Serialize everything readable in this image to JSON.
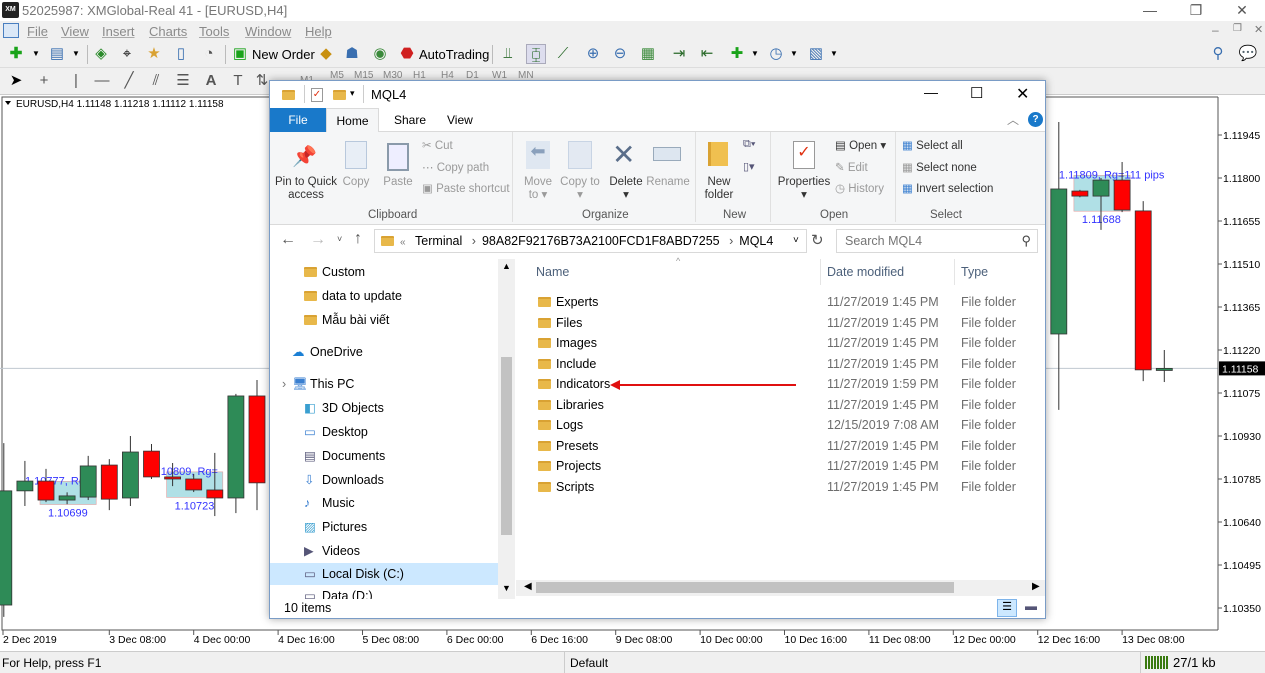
{
  "app": {
    "title": "52025987: XMGlobal-Real 41 - [EURUSD,H4]",
    "logo": "XM",
    "menu": [
      "File",
      "View",
      "Insert",
      "Charts",
      "Tools",
      "Window",
      "Help"
    ],
    "toolbar": {
      "new_order": "New Order",
      "autotrading": "AutoTrading"
    },
    "timeframes": [
      "M1",
      "M5",
      "M15",
      "M30",
      "H1",
      "H4",
      "D1",
      "W1",
      "MN"
    ],
    "status": {
      "help": "For Help, press F1",
      "profile": "Default",
      "traffic": "27/1 kb"
    }
  },
  "chart_data": {
    "type": "candlestick",
    "symbol_info": "EURUSD,H4  1.11148 1.11218 1.11112 1.11158",
    "current_price": "1.11158",
    "y_ticks": [
      "1.11945",
      "1.11800",
      "1.11655",
      "1.11510",
      "1.11365",
      "1.11220",
      "1.11075",
      "1.10930",
      "1.10785",
      "1.10640",
      "1.10495",
      "1.10350"
    ],
    "ylim": [
      1.103,
      1.1215
    ],
    "x_ticks": [
      {
        "t": "2019-12-02T00:00",
        "label": "2 Dec 2019"
      },
      {
        "t": "2019-12-03T08:00",
        "label": "3 Dec 08:00"
      },
      {
        "t": "2019-12-04T00:00",
        "label": "4 Dec 00:00"
      },
      {
        "t": "2019-12-04T16:00",
        "label": "4 Dec 16:00"
      },
      {
        "t": "2019-12-05T08:00",
        "label": "5 Dec 08:00"
      },
      {
        "t": "2019-12-06T00:00",
        "label": "6 Dec 00:00"
      },
      {
        "t": "2019-12-06T16:00",
        "label": "6 Dec 16:00"
      },
      {
        "t": "2019-12-09T08:00",
        "label": "9 Dec 08:00"
      },
      {
        "t": "2019-12-10T00:00",
        "label": "10 Dec 00:00"
      },
      {
        "t": "2019-12-10T16:00",
        "label": "10 Dec 16:00"
      },
      {
        "t": "2019-12-11T08:00",
        "label": "11 Dec 08:00"
      },
      {
        "t": "2019-12-12T00:00",
        "label": "12 Dec 00:00"
      },
      {
        "t": "2019-12-12T16:00",
        "label": "12 Dec 16:00"
      },
      {
        "t": "2019-12-13T08:00",
        "label": "13 Dec 08:00"
      }
    ],
    "candles": [
      {
        "t": "2019-12-02T12:00",
        "o": 1.1036,
        "h": 1.10906,
        "l": 1.1032,
        "c": 1.10745
      },
      {
        "t": "2019-12-02T16:00",
        "o": 1.10745,
        "h": 1.10846,
        "l": 1.10694,
        "c": 1.10778
      },
      {
        "t": "2019-12-02T20:00",
        "o": 1.10778,
        "h": 1.10819,
        "l": 1.10707,
        "c": 1.10714
      },
      {
        "t": "2019-12-03T00:00",
        "o": 1.10714,
        "h": 1.1074,
        "l": 1.107,
        "c": 1.10728
      },
      {
        "t": "2019-12-03T04:00",
        "o": 1.10724,
        "h": 1.10863,
        "l": 1.10714,
        "c": 1.10829
      },
      {
        "t": "2019-12-03T08:00",
        "o": 1.10832,
        "h": 1.10852,
        "l": 1.1068,
        "c": 1.10717
      },
      {
        "t": "2019-12-03T12:00",
        "o": 1.10721,
        "h": 1.1093,
        "l": 1.10694,
        "c": 1.10876
      },
      {
        "t": "2019-12-03T16:00",
        "o": 1.10879,
        "h": 1.10903,
        "l": 1.10785,
        "c": 1.10792
      },
      {
        "t": "2019-12-03T20:00",
        "o": 1.10792,
        "h": 1.10839,
        "l": 1.10761,
        "c": 1.10785
      },
      {
        "t": "2019-12-04T00:00",
        "o": 1.10785,
        "h": 1.10802,
        "l": 1.10741,
        "c": 1.10748
      },
      {
        "t": "2019-12-04T04:00",
        "o": 1.10748,
        "h": 1.10873,
        "l": 1.1066,
        "c": 1.10721
      },
      {
        "t": "2019-12-04T08:00",
        "o": 1.10721,
        "h": 1.11072,
        "l": 1.1067,
        "c": 1.11065
      },
      {
        "t": "2019-12-04T12:00",
        "o": 1.11065,
        "h": 1.11119,
        "l": 1.1068,
        "c": 1.10772
      },
      {
        "t": "2019-12-12T20:00",
        "o": 1.11274,
        "h": 1.11989,
        "l": 1.11018,
        "c": 1.11763
      },
      {
        "t": "2019-12-13T00:00",
        "o": 1.11756,
        "h": 1.1176,
        "l": 1.11735,
        "c": 1.11739
      },
      {
        "t": "2019-12-13T04:00",
        "o": 1.11739,
        "h": 1.118,
        "l": 1.11625,
        "c": 1.11793
      },
      {
        "t": "2019-12-13T08:00",
        "o": 1.11793,
        "h": 1.11854,
        "l": 1.11685,
        "c": 1.11692
      },
      {
        "t": "2019-12-13T12:00",
        "o": 1.11689,
        "h": 1.11722,
        "l": 1.11115,
        "c": 1.11153
      },
      {
        "t": "2019-12-13T16:00",
        "o": 1.11151,
        "h": 1.1122,
        "l": 1.11112,
        "c": 1.11158
      }
    ],
    "ranges": [
      {
        "t1": "2019-12-02T20:00",
        "t2": "2019-12-03T04:00",
        "hi": 1.10777,
        "lo": 1.10699,
        "top_label": "1.10777, Rg=",
        "bottom_label": "1.10699"
      },
      {
        "t1": "2019-12-03T20:00",
        "t2": "2019-12-04T04:00",
        "hi": 1.10809,
        "lo": 1.10723,
        "top_label": "1.10809, Rg=",
        "bottom_label": "1.10723"
      },
      {
        "t1": "2019-12-13T00:00",
        "t2": "2019-12-13T08:00",
        "hi": 1.11809,
        "lo": 1.11688,
        "top_label": "1.11809, Rg=111 pips",
        "bottom_label": "1.11688"
      }
    ],
    "colors": {
      "bull": "#2e8b57",
      "bear": "#ff0000",
      "range_fill": "#b0e0e6",
      "label": "#3333ff"
    }
  },
  "explorer": {
    "title": "MQL4",
    "tabs": [
      "File",
      "Home",
      "Share",
      "View"
    ],
    "active_tab": "Home",
    "ribbon": {
      "pin": "Pin to Quick access",
      "copy": "Copy",
      "paste": "Paste",
      "cut": "Cut",
      "copy_path": "Copy path",
      "paste_shortcut": "Paste shortcut",
      "clipboard": "Clipboard",
      "move_to": "Move to",
      "copy_to": "Copy to",
      "delete": "Delete",
      "rename": "Rename",
      "organize": "Organize",
      "new_folder": "New folder",
      "new": "New",
      "properties": "Properties",
      "open": "Open",
      "edit": "Edit",
      "history": "History",
      "open_grp": "Open",
      "select_all": "Select all",
      "select_none": "Select none",
      "invert": "Invert selection",
      "select": "Select"
    },
    "address": [
      "Terminal",
      "98A82F92176B73A2100FCD1F8ABD7255",
      "MQL4"
    ],
    "search_placeholder": "Search MQL4",
    "nav": [
      {
        "label": "Custom",
        "icon": "folder"
      },
      {
        "label": "data to update",
        "icon": "folder"
      },
      {
        "label": "Mẫu bài viết",
        "icon": "folder"
      },
      {
        "label": "OneDrive",
        "icon": "cloud"
      },
      {
        "label": "This PC",
        "icon": "computer"
      },
      {
        "label": "3D Objects",
        "icon": "3d"
      },
      {
        "label": "Desktop",
        "icon": "desktop"
      },
      {
        "label": "Documents",
        "icon": "documents"
      },
      {
        "label": "Downloads",
        "icon": "download"
      },
      {
        "label": "Music",
        "icon": "music"
      },
      {
        "label": "Pictures",
        "icon": "pictures"
      },
      {
        "label": "Videos",
        "icon": "videos"
      },
      {
        "label": "Local Disk (C:)",
        "icon": "drive",
        "selected": true
      },
      {
        "label": "Data (D:)",
        "icon": "drive"
      }
    ],
    "columns": [
      "Name",
      "Date modified",
      "Type"
    ],
    "files": [
      {
        "name": "Experts",
        "date": "11/27/2019 1:45 PM",
        "type": "File folder"
      },
      {
        "name": "Files",
        "date": "11/27/2019 1:45 PM",
        "type": "File folder"
      },
      {
        "name": "Images",
        "date": "11/27/2019 1:45 PM",
        "type": "File folder"
      },
      {
        "name": "Include",
        "date": "11/27/2019 1:45 PM",
        "type": "File folder"
      },
      {
        "name": "Indicators",
        "date": "11/27/2019 1:59 PM",
        "type": "File folder"
      },
      {
        "name": "Libraries",
        "date": "11/27/2019 1:45 PM",
        "type": "File folder"
      },
      {
        "name": "Logs",
        "date": "12/15/2019 7:08 AM",
        "type": "File folder"
      },
      {
        "name": "Presets",
        "date": "11/27/2019 1:45 PM",
        "type": "File folder"
      },
      {
        "name": "Projects",
        "date": "11/27/2019 1:45 PM",
        "type": "File folder"
      },
      {
        "name": "Scripts",
        "date": "11/27/2019 1:45 PM",
        "type": "File folder"
      }
    ],
    "item_count": "10 items",
    "annotation": {
      "arrow_target": "Indicators",
      "color": "#e01010"
    }
  }
}
